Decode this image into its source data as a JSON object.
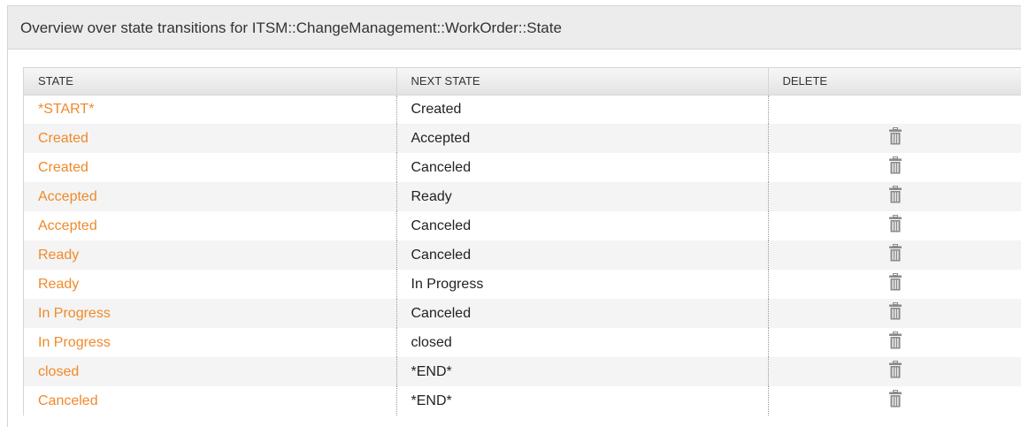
{
  "panel": {
    "title": "Overview over state transitions for ITSM::ChangeManagement::WorkOrder::State"
  },
  "table": {
    "headers": {
      "state": "STATE",
      "next_state": "NEXT STATE",
      "delete": "DELETE"
    },
    "rows": [
      {
        "state": "*START*",
        "next_state": "Created",
        "deletable": false
      },
      {
        "state": "Created",
        "next_state": "Accepted",
        "deletable": true
      },
      {
        "state": "Created",
        "next_state": "Canceled",
        "deletable": true
      },
      {
        "state": "Accepted",
        "next_state": "Ready",
        "deletable": true
      },
      {
        "state": "Accepted",
        "next_state": "Canceled",
        "deletable": true
      },
      {
        "state": "Ready",
        "next_state": "Canceled",
        "deletable": true
      },
      {
        "state": "Ready",
        "next_state": "In Progress",
        "deletable": true
      },
      {
        "state": "In Progress",
        "next_state": "Canceled",
        "deletable": true
      },
      {
        "state": "In Progress",
        "next_state": "closed",
        "deletable": true
      },
      {
        "state": "closed",
        "next_state": "*END*",
        "deletable": true
      },
      {
        "state": "Canceled",
        "next_state": "*END*",
        "deletable": true
      }
    ]
  },
  "colors": {
    "state_link": "#f0892a",
    "header_bg": "#ececec",
    "row_alt_bg": "#f4f4f4",
    "trash_icon": "#8a8a8a"
  },
  "icons": {
    "delete": "trash-icon"
  }
}
